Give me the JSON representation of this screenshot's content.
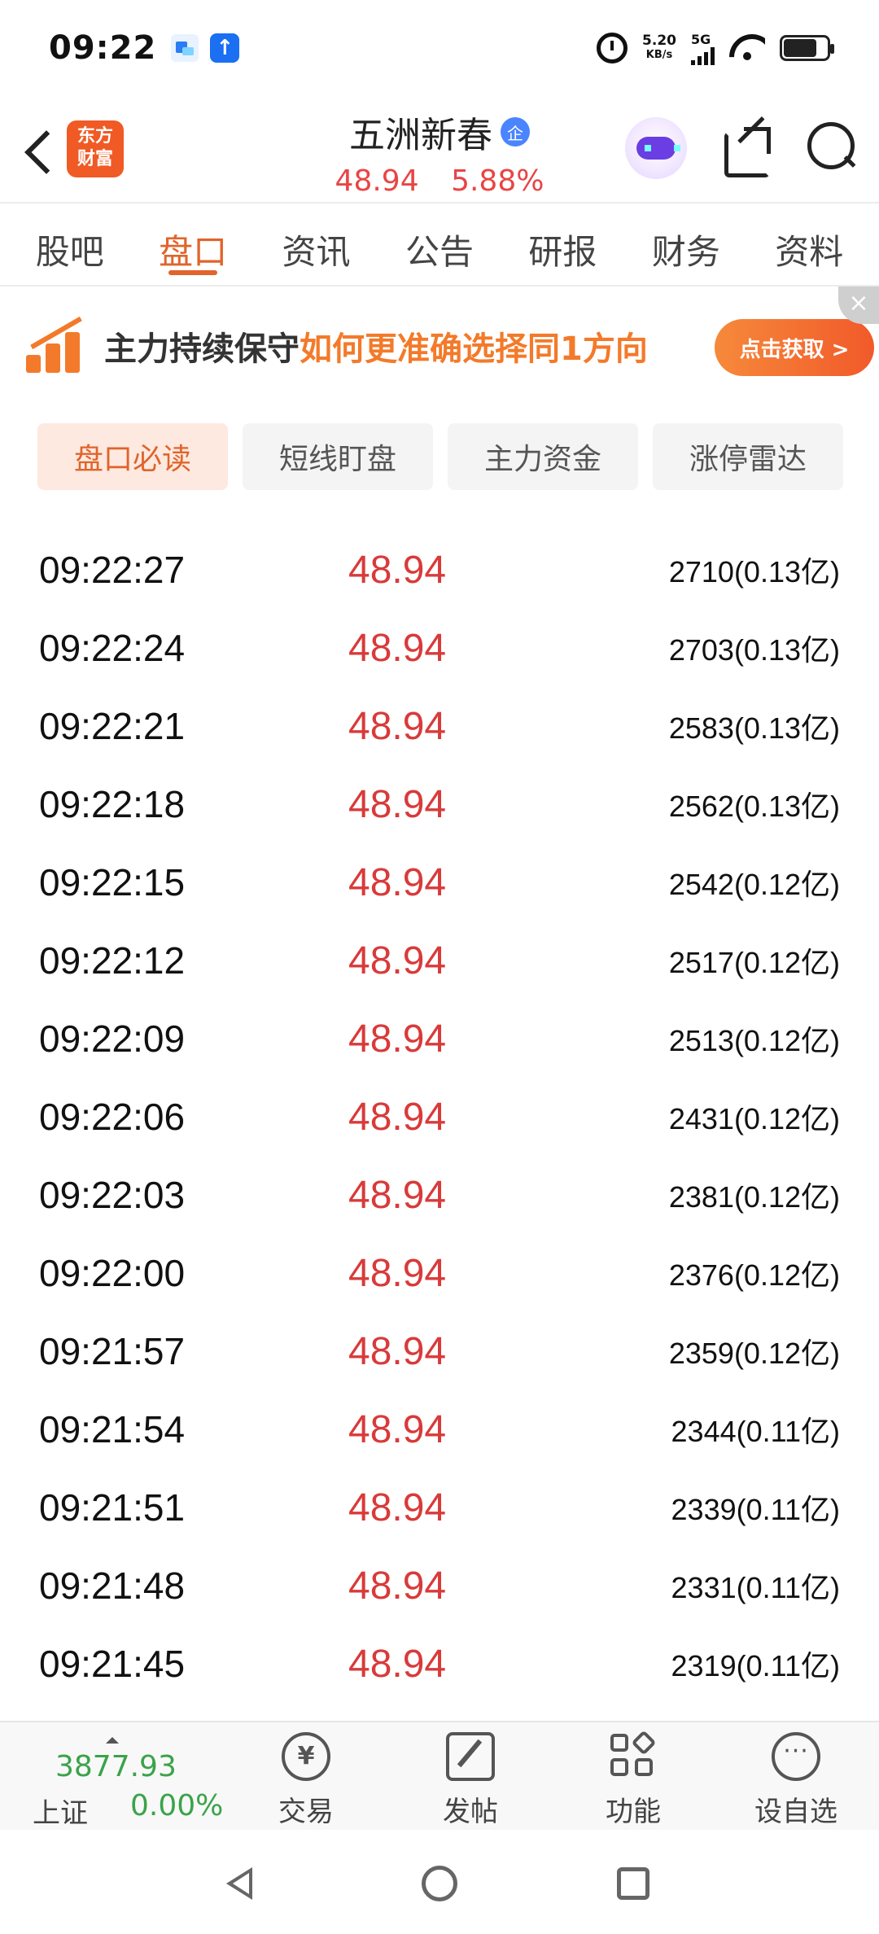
{
  "status_bar": {
    "time": "09:22",
    "net_speed_value": "5.20",
    "net_speed_unit": "KB/s",
    "network": "5G"
  },
  "header": {
    "logo_line1": "东方",
    "logo_line2": "财富",
    "stock_name": "五洲新春",
    "badge": "企",
    "price": "48.94",
    "change_pct": "5.88%"
  },
  "tabs": [
    {
      "label": "股吧"
    },
    {
      "label": "盘口"
    },
    {
      "label": "资讯"
    },
    {
      "label": "公告"
    },
    {
      "label": "研报"
    },
    {
      "label": "财务"
    },
    {
      "label": "资料"
    }
  ],
  "banner": {
    "text_main": "主力持续保守",
    "text_highlight": "如何更准确选择同1方向",
    "button": "点击获取 >",
    "close": "×"
  },
  "subtabs": [
    {
      "label": "盘口必读"
    },
    {
      "label": "短线盯盘"
    },
    {
      "label": "主力资金"
    },
    {
      "label": "涨停雷达"
    }
  ],
  "ticks": [
    {
      "time": "09:22:27",
      "price": "48.94",
      "volume": "2710(0.13亿)"
    },
    {
      "time": "09:22:24",
      "price": "48.94",
      "volume": "2703(0.13亿)"
    },
    {
      "time": "09:22:21",
      "price": "48.94",
      "volume": "2583(0.13亿)"
    },
    {
      "time": "09:22:18",
      "price": "48.94",
      "volume": "2562(0.13亿)"
    },
    {
      "time": "09:22:15",
      "price": "48.94",
      "volume": "2542(0.12亿)"
    },
    {
      "time": "09:22:12",
      "price": "48.94",
      "volume": "2517(0.12亿)"
    },
    {
      "time": "09:22:09",
      "price": "48.94",
      "volume": "2513(0.12亿)"
    },
    {
      "time": "09:22:06",
      "price": "48.94",
      "volume": "2431(0.12亿)"
    },
    {
      "time": "09:22:03",
      "price": "48.94",
      "volume": "2381(0.12亿)"
    },
    {
      "time": "09:22:00",
      "price": "48.94",
      "volume": "2376(0.12亿)"
    },
    {
      "time": "09:21:57",
      "price": "48.94",
      "volume": "2359(0.12亿)"
    },
    {
      "time": "09:21:54",
      "price": "48.94",
      "volume": "2344(0.11亿)"
    },
    {
      "time": "09:21:51",
      "price": "48.94",
      "volume": "2339(0.11亿)"
    },
    {
      "time": "09:21:48",
      "price": "48.94",
      "volume": "2331(0.11亿)"
    },
    {
      "time": "09:21:45",
      "price": "48.94",
      "volume": "2319(0.11亿)"
    }
  ],
  "bottom_bar": {
    "index_value": "3877.93",
    "index_name": "上证",
    "index_change": "0.00%",
    "trade_symbol": "¥",
    "trade_label": "交易",
    "post_label": "发帖",
    "func_label": "功能",
    "fav_symbol": "···",
    "fav_label": "设自选"
  }
}
